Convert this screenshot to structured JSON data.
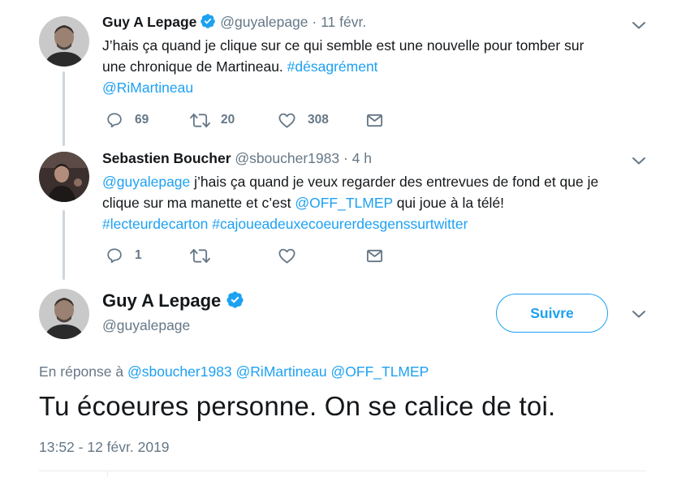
{
  "tweets": [
    {
      "name": "Guy A Lepage",
      "handle": "@guyalepage",
      "dot": "·",
      "time": "11 févr.",
      "text_line1": "J’hais ça quand je clique sur ce qui semble est une nouvelle pour tomber sur",
      "text_line2_pre": "une chronique de Martineau. ",
      "text_line2_link": "#désagrément",
      "text_line3_link": "@RiMartineau",
      "replies": "69",
      "retweets": "20",
      "likes": "308"
    },
    {
      "name": "Sebastien Boucher",
      "handle": "@sboucher1983",
      "dot": "·",
      "time": "4 h",
      "text_line1_link": "@guyalepage",
      "text_line1_rest": " j’hais ça quand je veux regarder des entrevues de fond et que je",
      "text_line2_pre": "clique sur ma manette et c’est ",
      "text_line2_link": "@OFF_TLMEP",
      "text_line2_post": " qui joue à la télé!",
      "text_line3_link1": "#lecteurdecarton",
      "text_line3_link2": "#cajoueadeuxecoeurerdesgenssurtwitter",
      "replies": "1"
    }
  ],
  "main_tweet": {
    "name": "Guy A Lepage",
    "handle": "@guyalepage",
    "follow_label": "Suivre",
    "reply_prefix": "En réponse à ",
    "reply_handles": [
      "@sboucher1983",
      "@RiMartineau",
      "@OFF_TLMEP"
    ],
    "text": "Tu écoeures personne. On se calice de toi.",
    "timestamp": "13:52 - 12 févr. 2019"
  },
  "icons": {
    "verified": "verified-badge-icon",
    "caret": "chevron-down-icon",
    "reply": "reply-icon",
    "retweet": "retweet-icon",
    "like": "heart-icon",
    "dm": "envelope-icon"
  },
  "colors": {
    "link": "#1da1f2",
    "muted": "#657786",
    "text": "#14171a",
    "line": "#ccd6dd"
  }
}
